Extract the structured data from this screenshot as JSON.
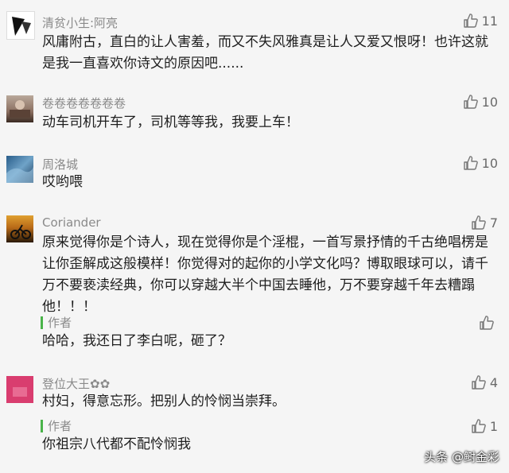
{
  "comments": [
    {
      "user": "清贫小生:阿亮",
      "likes": "11",
      "text": "风庸附古，直白的让人害羞，而又不失风雅真是让人又爱又恨呀！也许这就是我一直喜欢你诗文的原因吧......"
    },
    {
      "user": "卷卷卷卷卷卷卷",
      "likes": "10",
      "text": "动车司机开车了，司机等等我，我要上车！"
    },
    {
      "user": "周洛城",
      "likes": "10",
      "text": "哎哟喂"
    },
    {
      "user": "Coriander",
      "likes": "7",
      "text": "原来觉得你是个诗人，现在觉得你是个淫棍，一首写景抒情的千古绝唱楞是让你歪解成这般模样！你觉得对的起你的小学文化吗？博取眼球可以，请千万不要亵渎经典，你可以穿越大半个中国去睡他，万不要穿越千年去糟蹋他！！！",
      "reply": {
        "tag": "作者",
        "likes": "",
        "text": "哈哈，我还日了李白呢，砸了？"
      }
    },
    {
      "user": "登位大王✿✿",
      "likes": "4",
      "text": "村妇，得意忘形。把别人的怜悯当崇拜。",
      "reply": {
        "tag": "作者",
        "likes": "1",
        "text": "你祖宗八代都不配怜悯我"
      }
    }
  ],
  "watermark": "头条 @鲥金彩",
  "colors": {
    "author_bar": "#49b349",
    "name_gray": "#8a8a8a",
    "background": "#f5f5f5"
  }
}
